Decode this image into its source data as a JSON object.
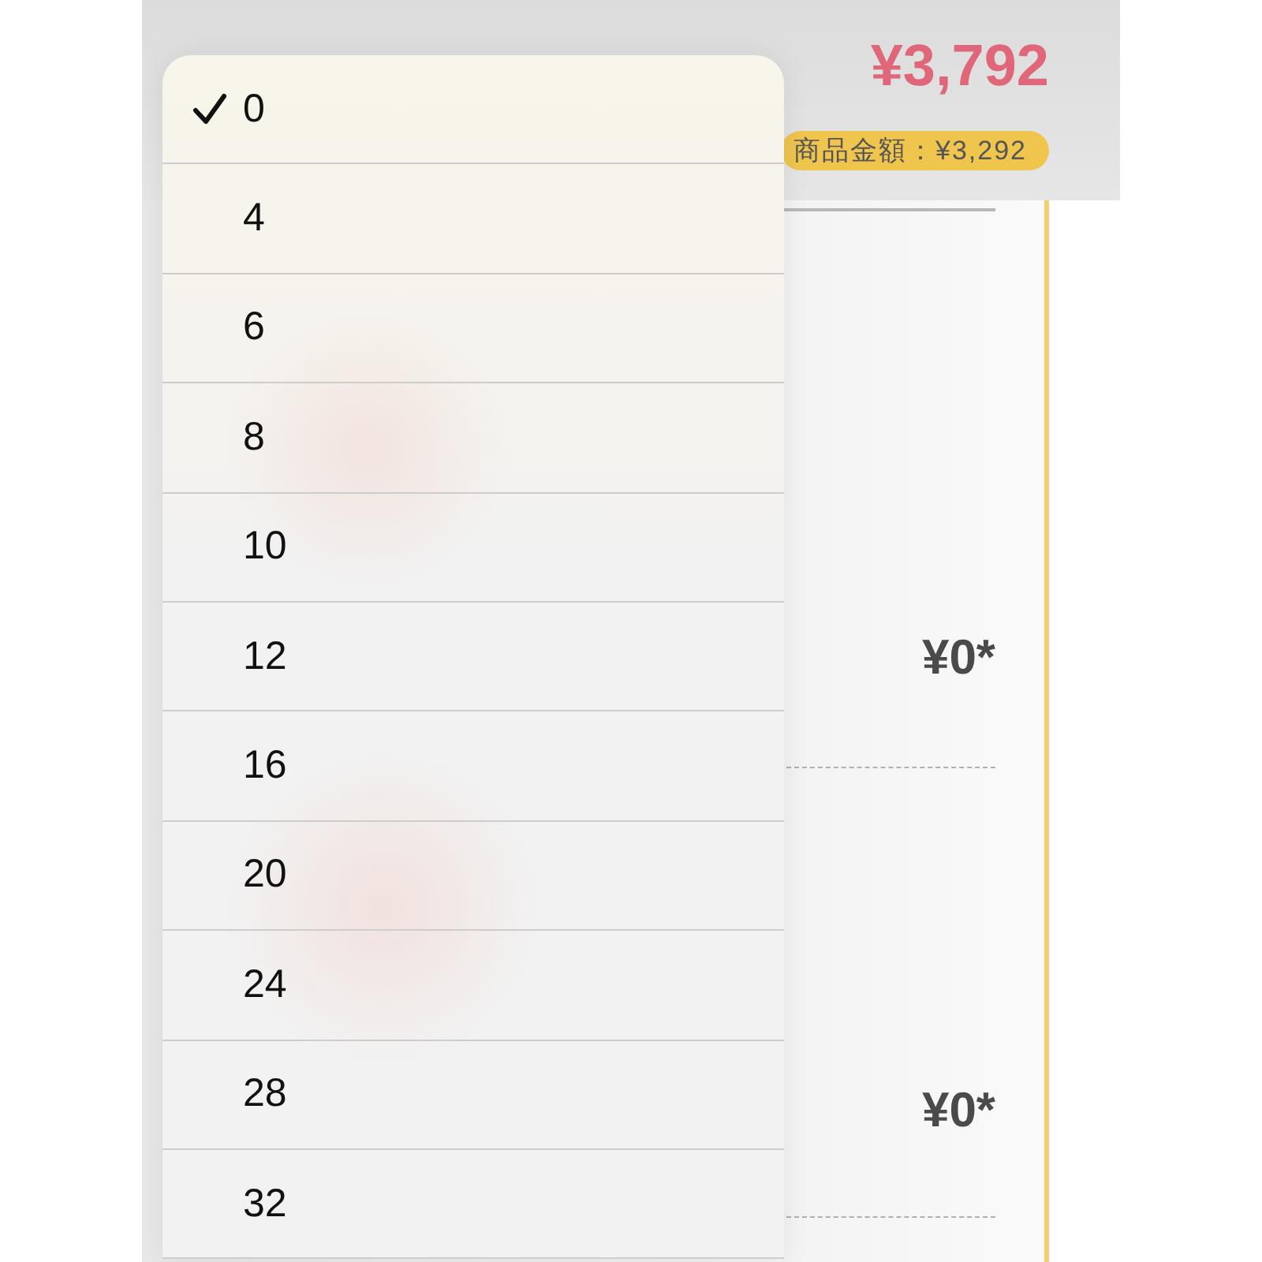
{
  "summary": {
    "total": "¥3,792",
    "subtotal_badge": "商品金額：¥3,292"
  },
  "items": [
    {
      "price": "¥0*"
    },
    {
      "price": "¥0*"
    }
  ],
  "menu": {
    "options": [
      {
        "label": "0",
        "selected": true
      },
      {
        "label": "4",
        "selected": false
      },
      {
        "label": "6",
        "selected": false
      },
      {
        "label": "8",
        "selected": false
      },
      {
        "label": "10",
        "selected": false
      },
      {
        "label": "12",
        "selected": false
      },
      {
        "label": "16",
        "selected": false
      },
      {
        "label": "20",
        "selected": false
      },
      {
        "label": "24",
        "selected": false
      },
      {
        "label": "28",
        "selected": false
      },
      {
        "label": "32",
        "selected": false
      }
    ]
  }
}
